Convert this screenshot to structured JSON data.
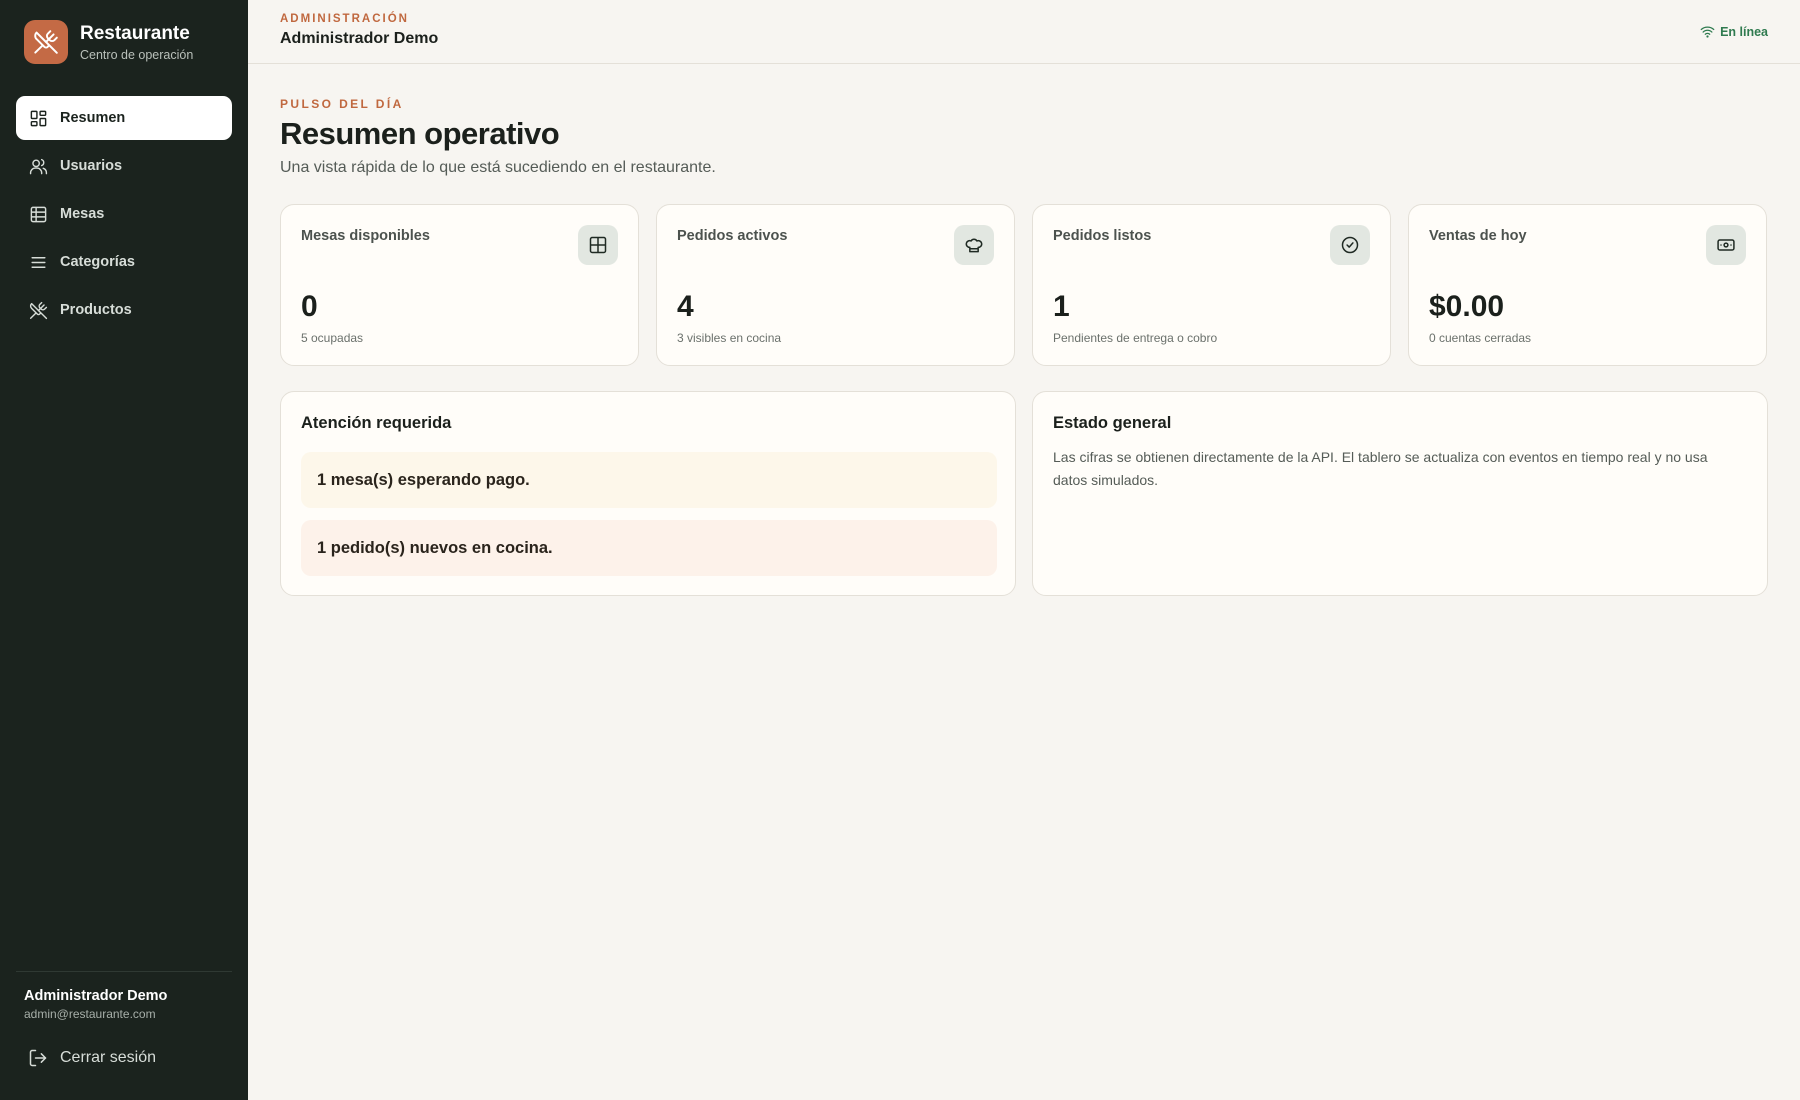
{
  "brand": {
    "title": "Restaurante",
    "subtitle": "Centro de operación",
    "logo_icon": "utensils-crossed-icon",
    "accent": "#c46a45"
  },
  "sidebar": {
    "items": [
      {
        "label": "Resumen",
        "icon": "dashboard-icon",
        "active": true
      },
      {
        "label": "Usuarios",
        "icon": "users-icon",
        "active": false
      },
      {
        "label": "Mesas",
        "icon": "table-grid-icon",
        "active": false
      },
      {
        "label": "Categorías",
        "icon": "list-icon",
        "active": false
      },
      {
        "label": "Productos",
        "icon": "utensils-crossed-icon",
        "active": false
      }
    ],
    "user": {
      "name": "Administrador Demo",
      "email": "admin@restaurante.com"
    },
    "logout_label": "Cerrar sesión"
  },
  "header": {
    "kicker": "ADMINISTRACIÓN",
    "title": "Administrador Demo",
    "status": "En línea",
    "status_color": "#2f7a4f"
  },
  "main": {
    "kicker": "PULSO DEL DÍA",
    "title": "Resumen operativo",
    "subtitle": "Una vista rápida de lo que está sucediendo en el restaurante.",
    "cards": [
      {
        "label": "Mesas disponibles",
        "value": "0",
        "note": "5 ocupadas",
        "icon": "table-grid-icon"
      },
      {
        "label": "Pedidos activos",
        "value": "4",
        "note": "3 visibles en cocina",
        "icon": "chef-hat-icon"
      },
      {
        "label": "Pedidos listos",
        "value": "1",
        "note": "Pendientes de entrega o cobro",
        "icon": "check-circle-icon"
      },
      {
        "label": "Ventas de hoy",
        "value": "$0.00",
        "note": "0 cuentas cerradas",
        "icon": "banknote-icon"
      }
    ],
    "attention": {
      "title": "Atención requerida",
      "items": [
        "1 mesa(s) esperando pago.",
        "1 pedido(s) nuevos en cocina."
      ]
    },
    "general": {
      "title": "Estado general",
      "text": "Las cifras se obtienen directamente de la API. El tablero se actualiza con eventos en tiempo real y no usa datos simulados."
    }
  }
}
